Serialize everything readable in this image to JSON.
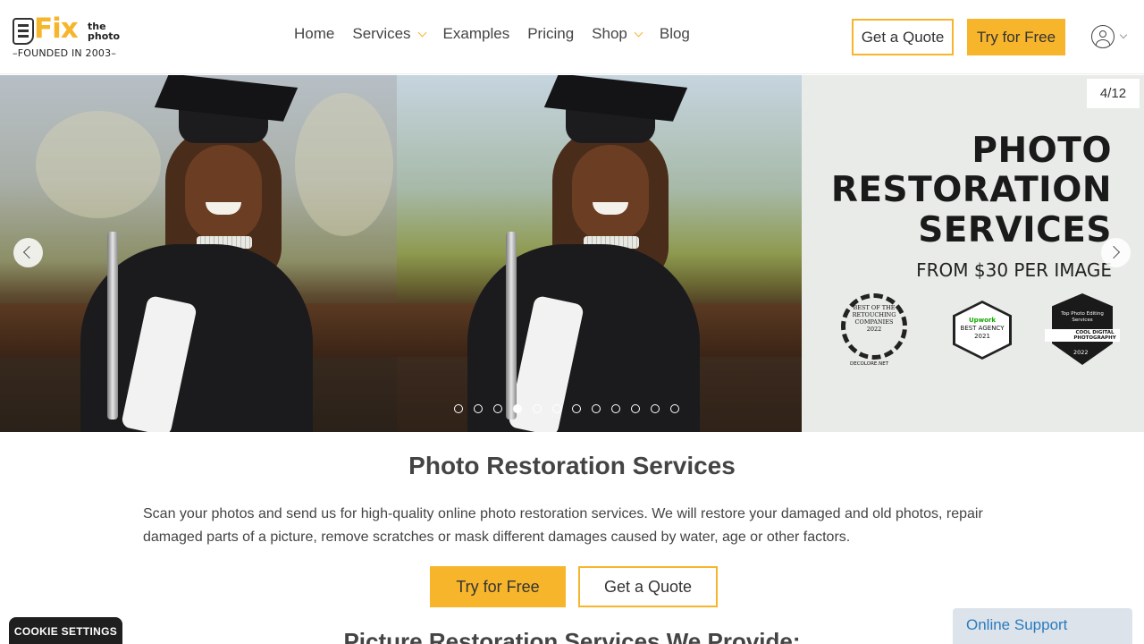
{
  "logo": {
    "brand": "Fix",
    "sub": "the photo",
    "founded": "FOUNDED IN 2003"
  },
  "nav": {
    "items": [
      {
        "label": "Home",
        "dropdown": false
      },
      {
        "label": "Services",
        "dropdown": true
      },
      {
        "label": "Examples",
        "dropdown": false
      },
      {
        "label": "Pricing",
        "dropdown": false
      },
      {
        "label": "Shop",
        "dropdown": true
      },
      {
        "label": "Blog",
        "dropdown": false
      }
    ]
  },
  "header": {
    "quote_label": "Get a Quote",
    "try_label": "Try for Free"
  },
  "slider": {
    "counter": "4/12",
    "current": 4,
    "total": 12,
    "promo": {
      "line1": "PHOTO",
      "line2": "RESTORATION",
      "line3": "SERVICES",
      "line4": "FROM $30 PER IMAGE"
    },
    "badges": {
      "b1": {
        "text": "BEST OF THE RETOUCHING COMPANIES 2022",
        "foot": "DECOLORE.NET"
      },
      "b2": {
        "brand": "Upwork",
        "text": "BEST AGENCY 2021"
      },
      "b3": {
        "text": "Top Photo Editing Services",
        "ribbon": "COOL DIGITAL PHOTOGRAPHY",
        "year": "2022"
      }
    }
  },
  "content": {
    "title": "Photo Restoration Services",
    "description": "Scan your photos and send us for high-quality online photo restoration services. We will restore your damaged and old photos, repair damaged parts of a picture, remove scratches or mask different damages caused by water, age or other factors.",
    "try_label": "Try for Free",
    "quote_label": "Get a Quote",
    "subtitle": "Picture Restoration Services We Provide:"
  },
  "cookie": {
    "label": "COOKIE SETTINGS"
  },
  "support": {
    "label": "Online Support"
  },
  "colors": {
    "accent": "#f7b52c",
    "text": "#444444",
    "support_link": "#2a7bbf"
  }
}
